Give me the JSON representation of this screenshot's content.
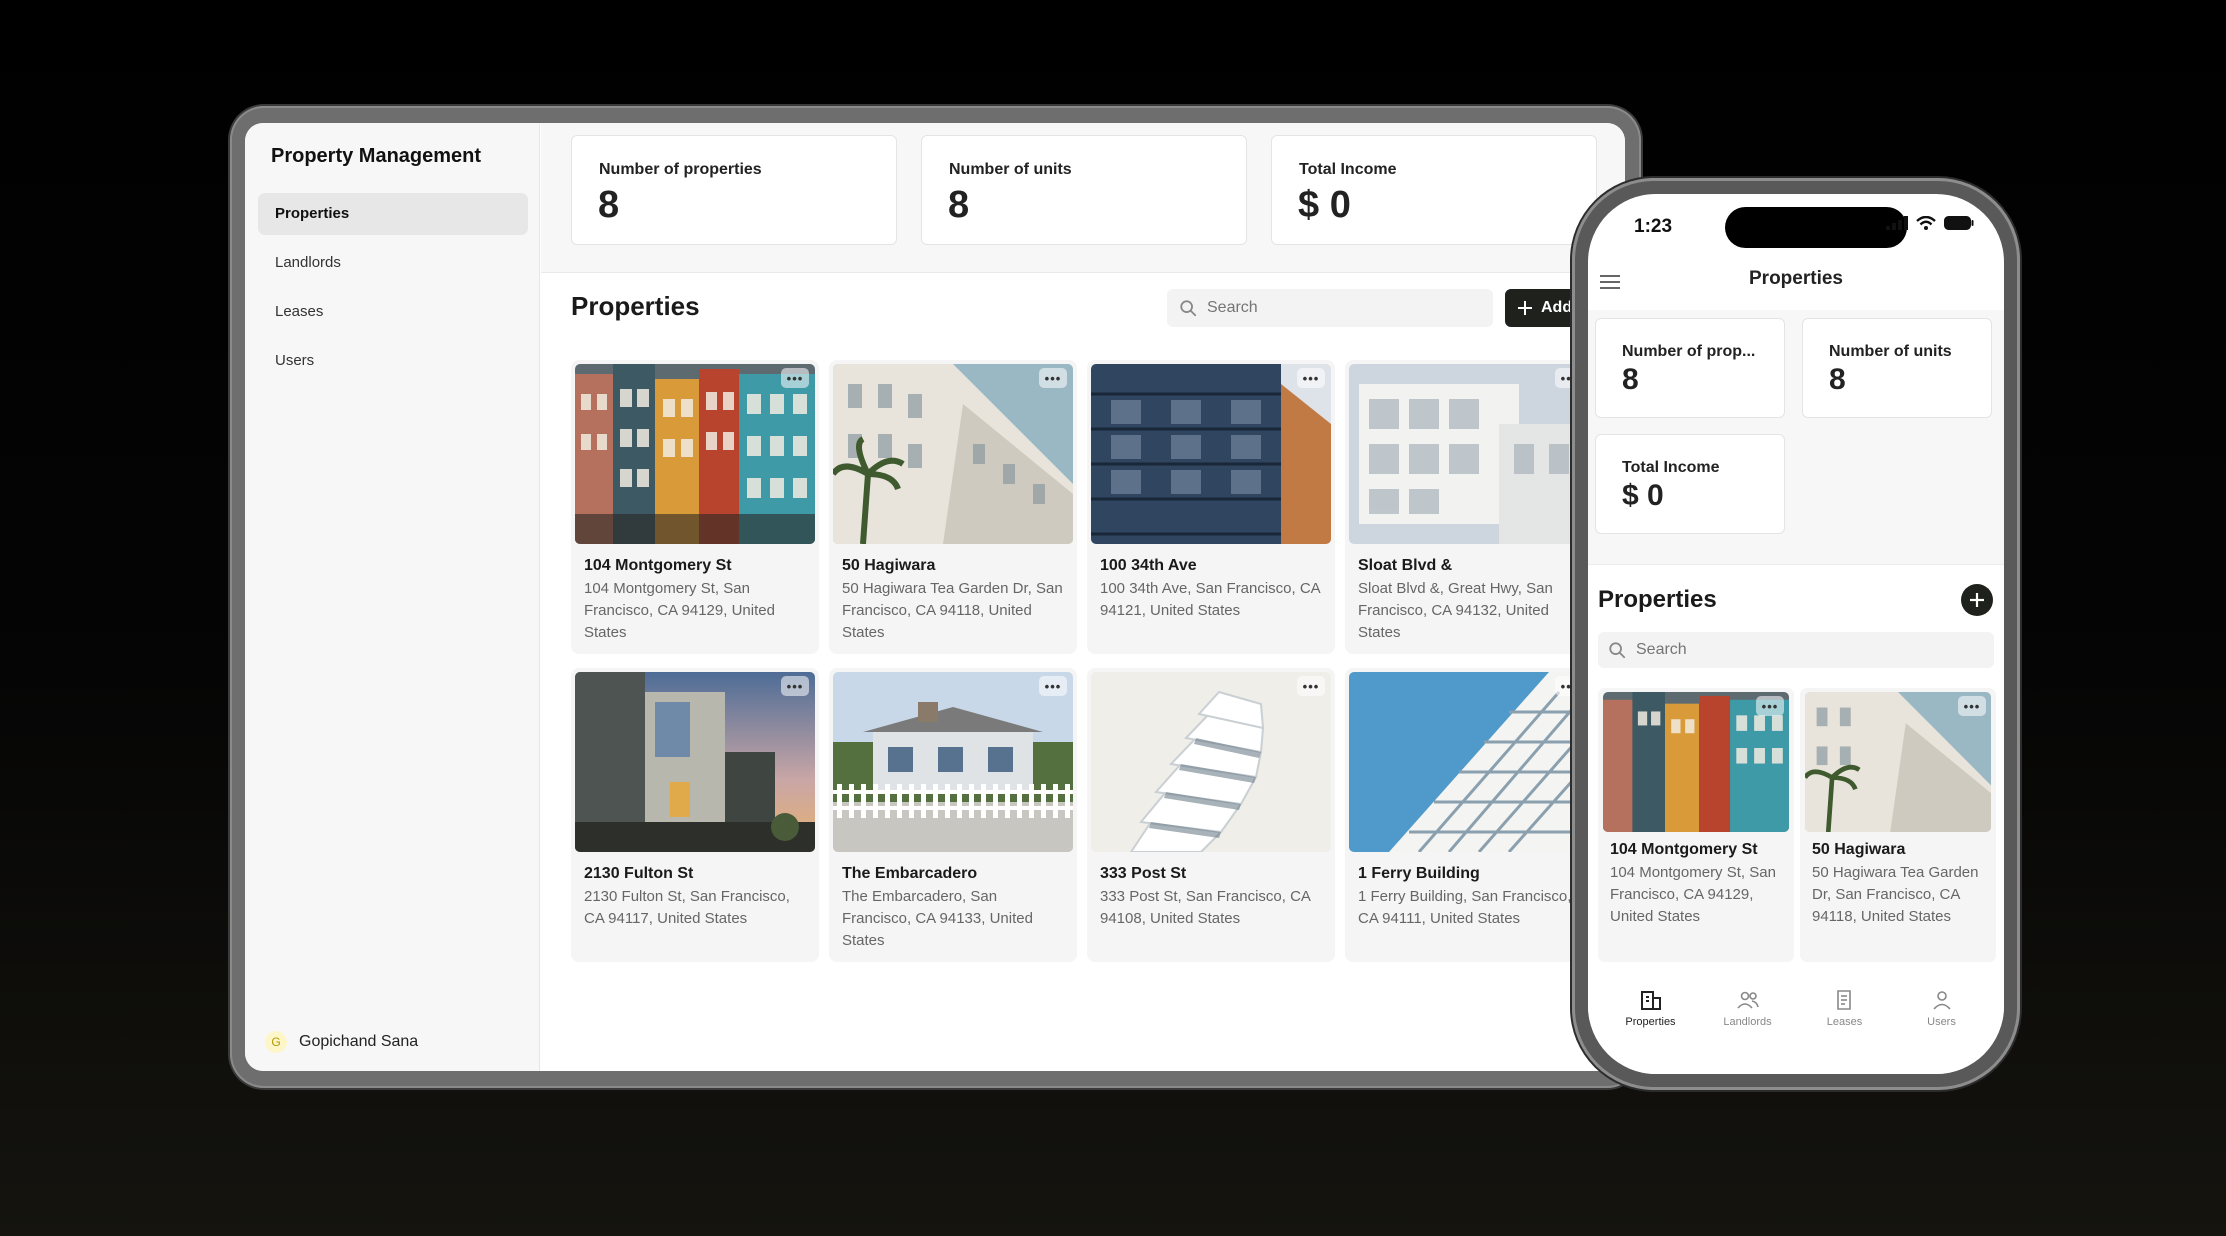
{
  "app": {
    "title": "Property Management"
  },
  "sidebar": {
    "items": [
      {
        "label": "Properties",
        "active": true
      },
      {
        "label": "Landlords"
      },
      {
        "label": "Leases"
      },
      {
        "label": "Users"
      }
    ],
    "user": {
      "initial": "G",
      "name": "Gopichand Sana"
    }
  },
  "stats": [
    {
      "label": "Number of properties",
      "value": "8"
    },
    {
      "label": "Number of units",
      "value": "8"
    },
    {
      "label": "Total Income",
      "value": "$ 0"
    }
  ],
  "main": {
    "title": "Properties",
    "search_placeholder": "Search",
    "add_label": "Add"
  },
  "properties": [
    {
      "name": "104 Montgomery St",
      "address": "104 Montgomery St, San Francisco, CA 94129, United States",
      "image": "colorful-rowhouses"
    },
    {
      "name": "50 Hagiwara",
      "address": "50 Hagiwara Tea Garden Dr, San Francisco, CA 94118, United States",
      "image": "white-apartment-palm"
    },
    {
      "name": "100 34th Ave",
      "address": "100 34th Ave, San Francisco, CA 94121, United States",
      "image": "blue-balcony-building"
    },
    {
      "name": "Sloat Blvd &",
      "address": "Sloat Blvd &, Great Hwy, San Francisco, CA 94132, United States",
      "image": "white-cube-building"
    },
    {
      "name": "2130 Fulton St",
      "address": "2130 Fulton St, San Francisco, CA 94117, United States",
      "image": "modern-house-dusk"
    },
    {
      "name": "The Embarcadero",
      "address": "The Embarcadero, San Francisco, CA 94133, United States",
      "image": "house-white-fence"
    },
    {
      "name": "333 Post St",
      "address": "333 Post St, San Francisco, CA 94108, United States",
      "image": "white-tiered-tower"
    },
    {
      "name": "1 Ferry Building",
      "address": "1 Ferry Building, San Francisco, CA 94111, United States",
      "image": "white-grid-tower"
    }
  ],
  "phone": {
    "time": "1:23",
    "header_title": "Properties",
    "stats": [
      {
        "label": "Number of prop...",
        "value": "8"
      },
      {
        "label": "Number of units",
        "value": "8"
      },
      {
        "label": "Total Income",
        "value": "$ 0"
      }
    ],
    "title": "Properties",
    "search_placeholder": "Search",
    "cards": [
      {
        "name": "104 Montgomery St",
        "address": "104 Montgomery St, San Francisco, CA 94129, United States"
      },
      {
        "name": "50 Hagiwara",
        "address": "50 Hagiwara Tea Garden Dr, San Francisco, CA 94118, United States"
      }
    ],
    "tabs": [
      {
        "label": "Properties",
        "icon": "building-icon",
        "active": true
      },
      {
        "label": "Landlords",
        "icon": "users-icon"
      },
      {
        "label": "Leases",
        "icon": "document-icon"
      },
      {
        "label": "Users",
        "icon": "user-icon"
      }
    ]
  },
  "colors": {
    "accent": "#1f211c",
    "sidebar_bg": "#f7f7f7",
    "card_bg": "#f5f5f5"
  }
}
